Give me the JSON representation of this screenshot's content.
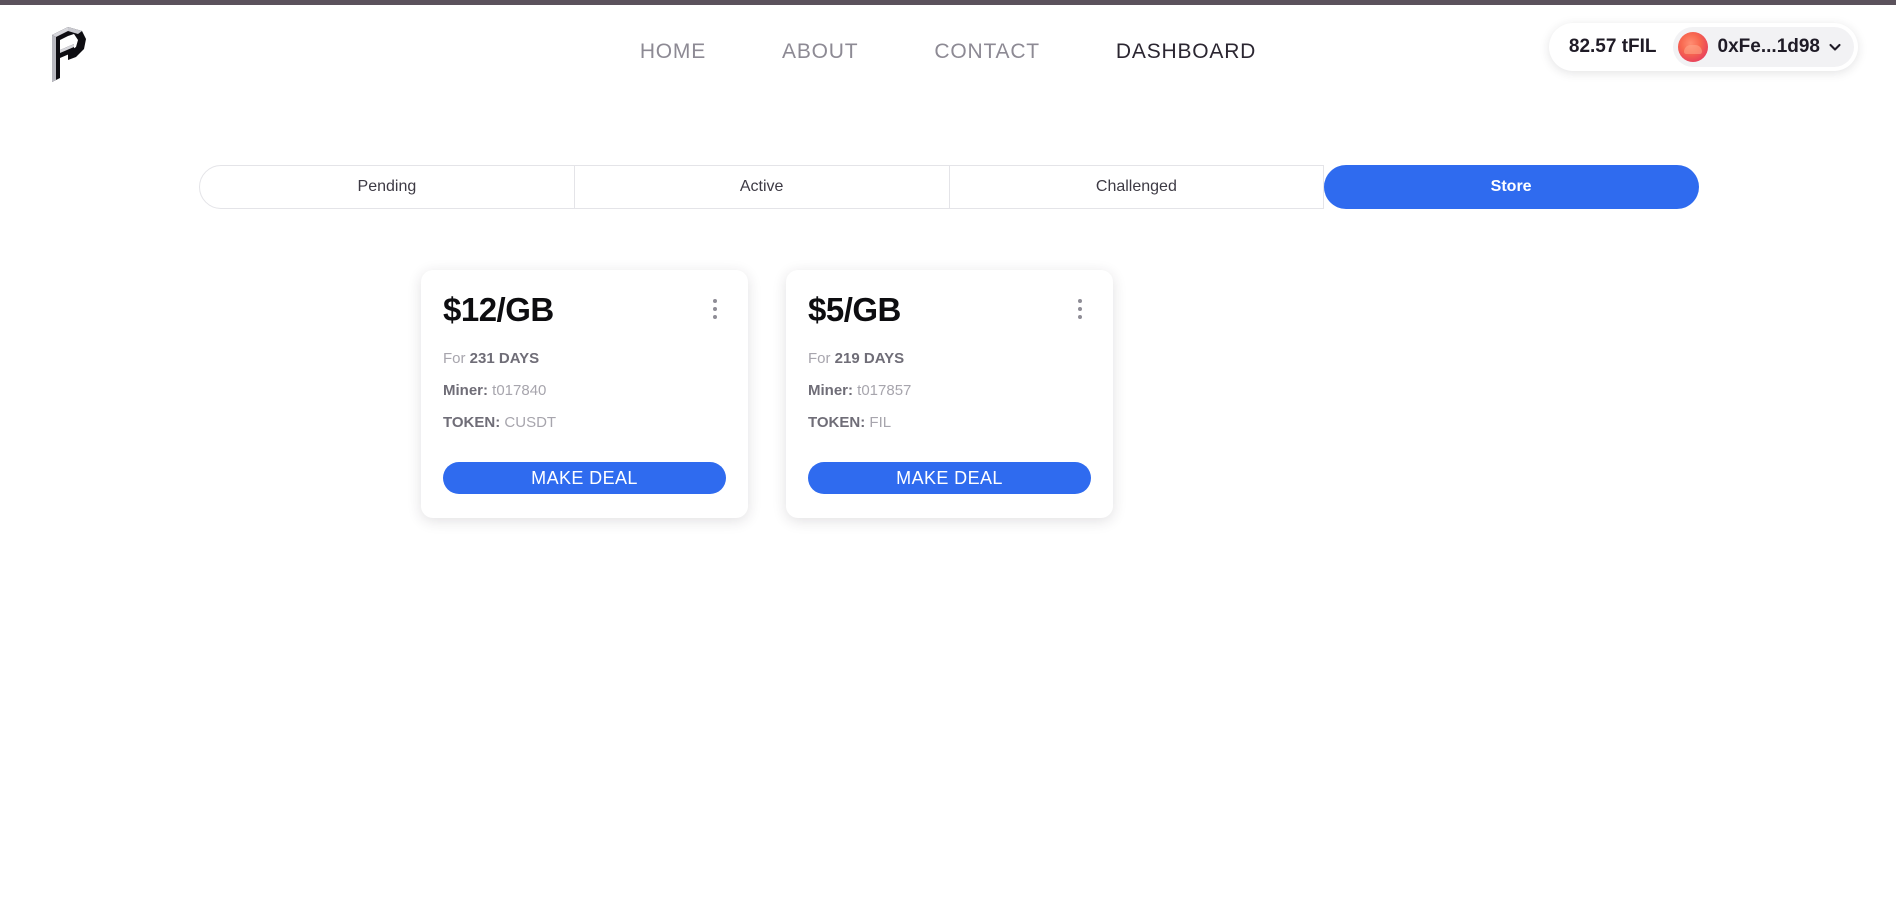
{
  "theme": {
    "accent_blue": "#2f6bef",
    "top_bar": "#5b525c",
    "text_dark": "#1f1b26",
    "text_muted": "#8d8a94"
  },
  "header": {
    "logo_name": "filecoin-f-logo",
    "nav": [
      {
        "label": "HOME",
        "active": false
      },
      {
        "label": "ABOUT",
        "active": false
      },
      {
        "label": "CONTACT",
        "active": false
      },
      {
        "label": "DASHBOARD",
        "active": true
      }
    ],
    "wallet": {
      "balance": "82.57 tFIL",
      "address": "0xFe...1d98",
      "avatar_name": "wallet-blockie-avatar",
      "chevron_name": "chevron-down-icon"
    }
  },
  "tabs": [
    {
      "label": "Pending",
      "active": false
    },
    {
      "label": "Active",
      "active": false
    },
    {
      "label": "Challenged",
      "active": false
    },
    {
      "label": "Store",
      "active": true
    }
  ],
  "cards": [
    {
      "price": "$12/GB",
      "duration_prefix": "For",
      "duration": "231 DAYS",
      "miner_label": "Miner:",
      "miner": "t017840",
      "token_label": "TOKEN:",
      "token": "CUSDT",
      "action_label": "MAKE DEAL",
      "menu_name": "card-kebab-menu"
    },
    {
      "price": "$5/GB",
      "duration_prefix": "For",
      "duration": "219 DAYS",
      "miner_label": "Miner:",
      "miner": "t017857",
      "token_label": "TOKEN:",
      "token": "FIL",
      "action_label": "MAKE DEAL",
      "menu_name": "card-kebab-menu"
    }
  ]
}
